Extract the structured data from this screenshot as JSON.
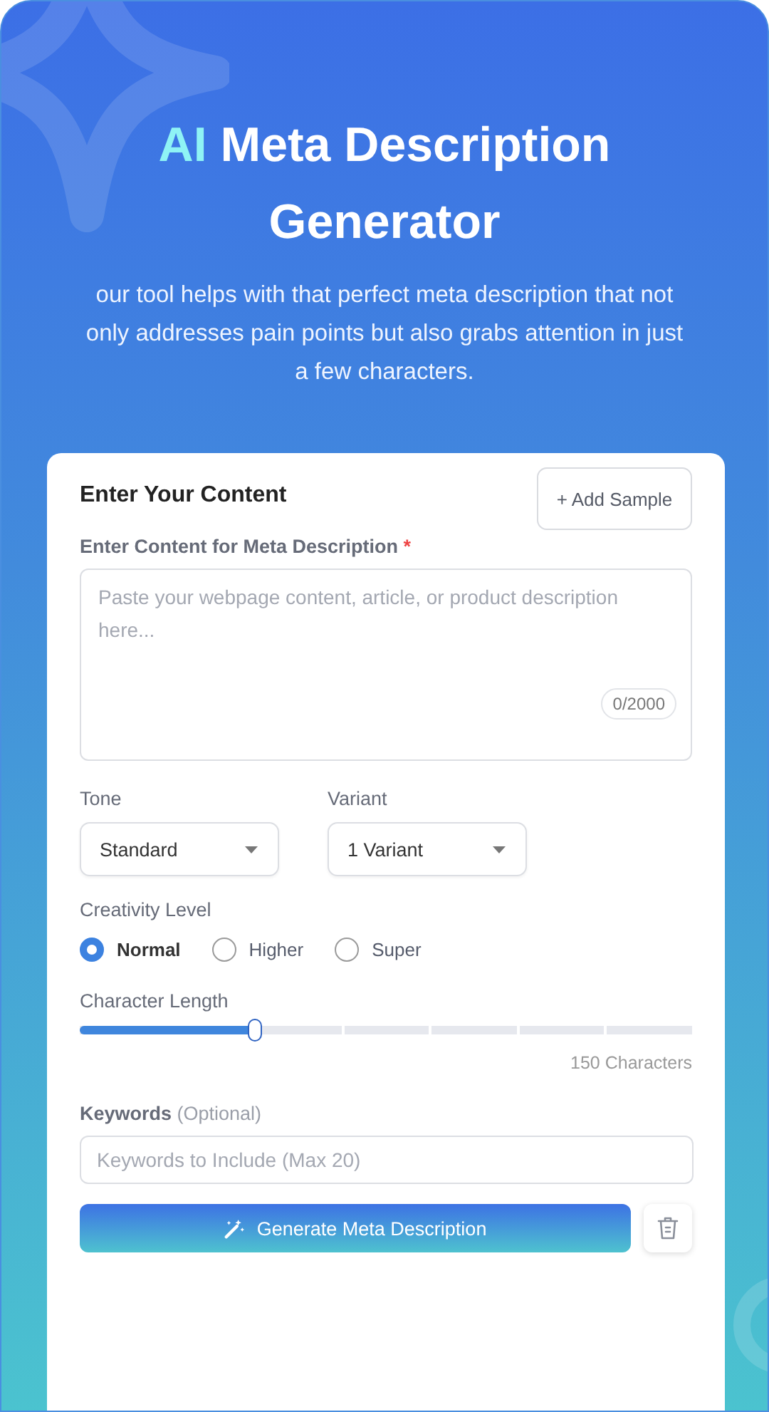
{
  "header": {
    "title": {
      "highlight": "AI",
      "text": "Meta Description Generator"
    },
    "subtitle": "our tool helps with that perfect meta description that not only addresses pain points but also grabs attention in just a few characters."
  },
  "form": {
    "heading": "Enter Your Content",
    "sample_button": "+ Add Sample",
    "content_field": {
      "label": "Enter Content for Meta Description",
      "required_mark": "*",
      "placeholder": "Paste your webpage content, article, or product description here...",
      "counter": "0/2000"
    },
    "selects": [
      {
        "label": "Tone",
        "value": "Standard"
      },
      {
        "label": "Variant",
        "value": "1 Variant"
      }
    ],
    "creativity": {
      "label": "Creativity Level",
      "options": [
        {
          "label": "Normal",
          "selected": true
        },
        {
          "label": "Higher",
          "selected": false
        },
        {
          "label": "Super",
          "selected": false
        }
      ]
    },
    "length": {
      "label": "Character Length",
      "level": 0.285,
      "reading": "150 Characters"
    },
    "keywords": {
      "label": "**Keywords** (Optional)",
      "placeholder": "Keywords to Include (Max 20)"
    },
    "generate_button": "Generate Meta Description"
  }
}
